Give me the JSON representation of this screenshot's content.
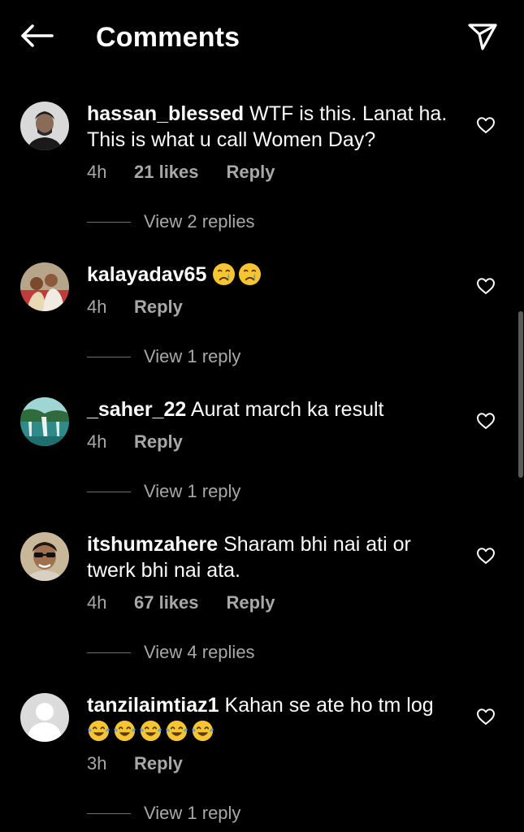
{
  "header": {
    "title": "Comments",
    "back_icon": "arrow-left-icon",
    "share_icon": "paper-plane-icon"
  },
  "comments": [
    {
      "username": "hassan_blessed",
      "text": "WTF is this. Lanat ha. This is what u call Women Day?",
      "time": "4h",
      "likes": "21 likes",
      "reply": "Reply",
      "view_replies": "View 2 replies"
    },
    {
      "username": "kalayadav65",
      "emojis": [
        "crying-face",
        "crying-face"
      ],
      "time": "4h",
      "reply": "Reply",
      "view_replies": "View 1 reply"
    },
    {
      "username": "_saher_22",
      "text": "Aurat march ka result",
      "time": "4h",
      "reply": "Reply",
      "view_replies": "View 1 reply"
    },
    {
      "username": "itshumzahere",
      "text": "Sharam bhi nai ati or twerk bhi nai ata.",
      "time": "4h",
      "likes": "67 likes",
      "reply": "Reply",
      "view_replies": "View 4 replies"
    },
    {
      "username": "tanzilaimtiaz1",
      "text": "Kahan se ate ho tm log",
      "emojis": [
        "tears-of-joy",
        "tears-of-joy",
        "tears-of-joy",
        "tears-of-joy",
        "tears-of-joy"
      ],
      "time": "3h",
      "reply": "Reply",
      "view_replies": "View 1 reply"
    }
  ],
  "colors": {
    "background": "#000000",
    "text": "#fafafa",
    "secondary": "#a8a8a8"
  }
}
